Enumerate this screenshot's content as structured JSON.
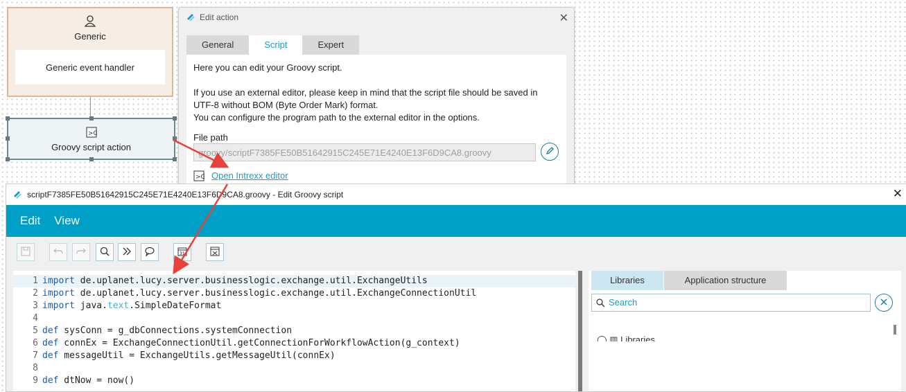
{
  "canvas": {
    "generic_title": "Generic",
    "generic_handler": "Generic event handler",
    "groovy_action_label": "Groovy script action"
  },
  "edit_action": {
    "title": "Edit action",
    "tabs": [
      {
        "label": "General",
        "active": false
      },
      {
        "label": "Script",
        "active": true
      },
      {
        "label": "Expert",
        "active": false
      }
    ],
    "intro": "Here you can edit your Groovy script.",
    "note_line1": "If you use an external editor, please keep in mind that the script file should be saved in",
    "note_line2": "UTF-8 without BOM (Byte Order Mark) format.",
    "note_line3": "You can configure the program path to the external editor in the options.",
    "file_path_label": "File path",
    "file_path_value": "groovy/scriptF7385FE50B51642915C245E71E4240E13F6D9CA8.groovy",
    "open_link": "Open Intrexx editor"
  },
  "groovy_editor": {
    "title": "scriptF7385FE50B51642915C245E71E4240E13F6D9CA8.groovy - Edit Groovy script",
    "menu": [
      "Edit",
      "View"
    ],
    "toolbar_icons": [
      "save-icon",
      "undo-icon",
      "redo-icon",
      "search-icon",
      "next-icon",
      "comment-icon",
      "calendar-icon",
      "clear-icon"
    ],
    "code_lines": [
      {
        "n": "1",
        "kw": "import",
        "pk": "",
        "rest": " de.uplanet.lucy.server.businesslogic.exchange.util.ExchangeUtils"
      },
      {
        "n": "2",
        "kw": "import",
        "pk": "",
        "rest": " de.uplanet.lucy.server.businesslogic.exchange.util.ExchangeConnectionUtil"
      },
      {
        "n": "3",
        "kw": "import",
        "pre": " java.",
        "pk": "text",
        "rest": ".SimpleDateFormat"
      },
      {
        "n": "4",
        "kw": "",
        "pk": "",
        "rest": ""
      },
      {
        "n": "5",
        "kw": "def",
        "pk": "",
        "rest": " sysConn = g_dbConnections.systemConnection"
      },
      {
        "n": "6",
        "kw": "def",
        "pk": "",
        "rest": " connEx = ExchangeConnectionUtil.getConnectionForWorkflowAction(g_context)"
      },
      {
        "n": "7",
        "kw": "def",
        "pk": "",
        "rest": " messageUtil = ExchangeUtils.getMessageUtil(connEx)"
      },
      {
        "n": "8",
        "kw": "",
        "pk": "",
        "rest": ""
      },
      {
        "n": "9",
        "kw": "def",
        "pk": "",
        "rest": " dtNow = now()"
      }
    ],
    "right_tabs": [
      "Libraries",
      "Application structure"
    ],
    "search_placeholder": "Search",
    "tree_first": "Libraries"
  },
  "colors": {
    "accent": "#00a0c6",
    "link": "#1e9bc4",
    "arrow": "#e8413b"
  }
}
